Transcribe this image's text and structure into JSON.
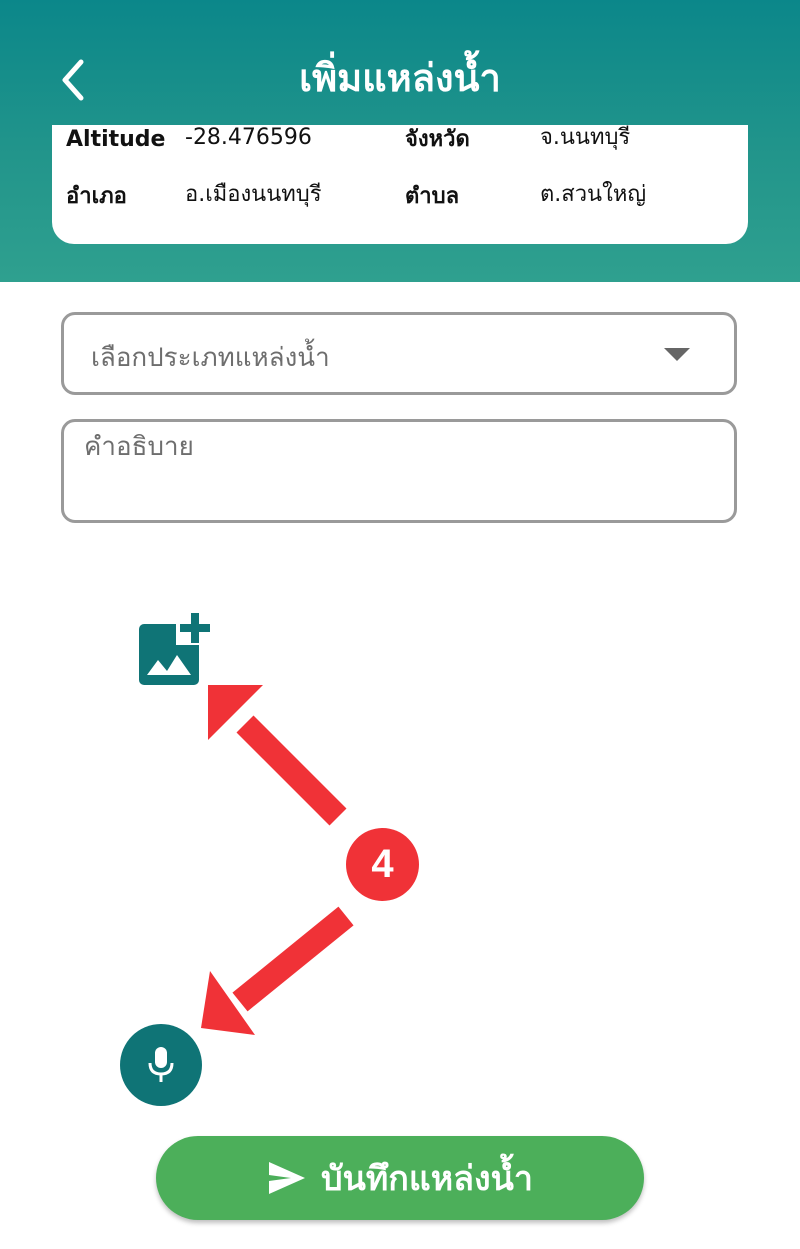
{
  "header": {
    "title": "เพิ่มแหล่งน้ำ",
    "background_color": "#0b878a",
    "back_icon": "chevron-left-icon"
  },
  "location_info": {
    "altitude_label": "Altitude",
    "altitude_value": "-28.476596",
    "province_label": "จังหวัด",
    "province_value": "จ.นนทบุรี",
    "district_label": "อำเภอ",
    "district_value": "อ.เมืองนนทบุรี",
    "subdistrict_label": "ตำบล",
    "subdistrict_value": "ต.สวนใหญ่"
  },
  "form": {
    "water_type_select": {
      "selected_text": "เลือกประเภทแหล่งน้ำ",
      "icon": "caret-down-icon"
    },
    "description": {
      "placeholder": "คำอธิบาย",
      "value": ""
    }
  },
  "media": {
    "add_photo_icon": "add-photo-icon",
    "mic_icon": "microphone-icon",
    "accent_color": "#0f7476"
  },
  "annotation": {
    "step_number": "4",
    "color": "#f03237"
  },
  "actions": {
    "save_label": "บันทึกแหล่งน้ำ",
    "save_icon": "send-icon",
    "save_color": "#4caf5a"
  }
}
